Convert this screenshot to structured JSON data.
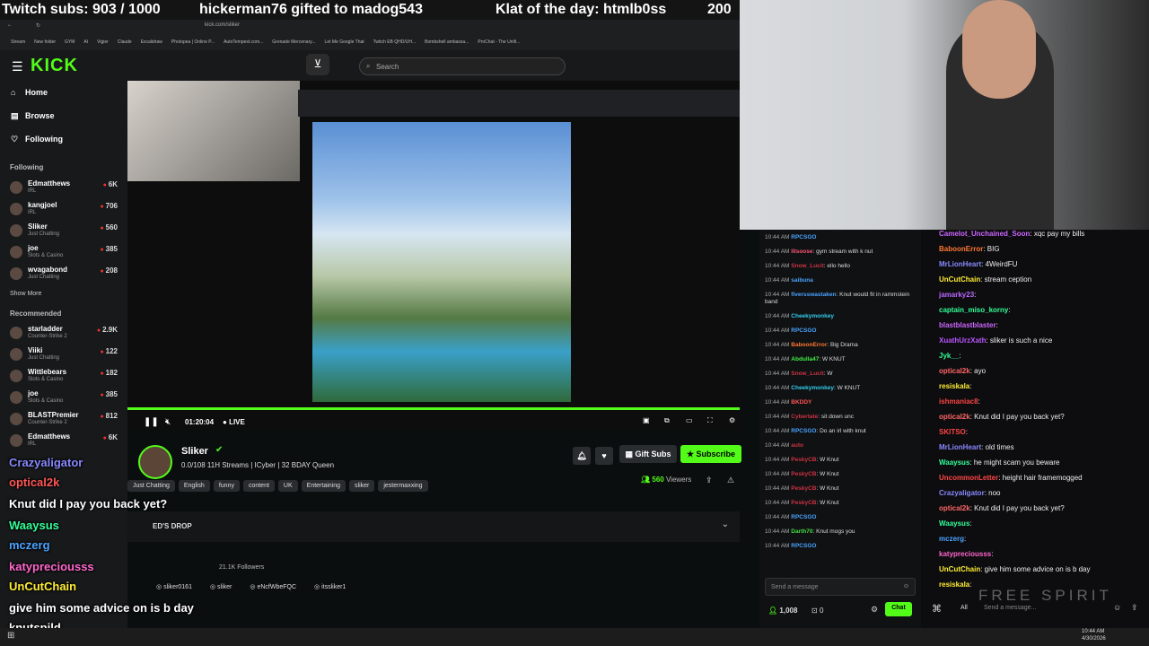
{
  "overlay": {
    "sub_count": "Twitch subs: 903 / 1000",
    "gift": "hickerman76 gifted to madog543",
    "klat": "Klat of the day: htmlb0ss",
    "klat_num": "200"
  },
  "browser": {
    "url": "kick.com/sliker",
    "bookmarks": [
      "Stream",
      "New folder",
      "GYM",
      "AI",
      "Vigier",
      "Claude",
      "Excalidraw",
      "Photopea | Online P...",
      "AutoTempest.com...",
      "Grenade Mercenary...",
      "Let Me Google That",
      "Twitch EB QHD/UH...",
      "Bombshell ambassa...",
      "ProChat - The Unifi..."
    ]
  },
  "kick": {
    "logo": "KICK",
    "search_placeholder": "Search",
    "nav": [
      {
        "label": "Home",
        "icon": "home-icon"
      },
      {
        "label": "Browse",
        "icon": "browse-icon"
      },
      {
        "label": "Following",
        "icon": "heart-icon"
      }
    ],
    "following_heading": "Following",
    "following": [
      {
        "name": "Edmatthews",
        "cat": "IRL",
        "viewers": "6K"
      },
      {
        "name": "kangjoel",
        "cat": "IRL",
        "viewers": "706"
      },
      {
        "name": "Sliker",
        "cat": "Just Chatting",
        "viewers": "560"
      },
      {
        "name": "joe",
        "cat": "Slots & Casino",
        "viewers": "385"
      },
      {
        "name": "wvagabond",
        "cat": "Just Chatting",
        "viewers": "208"
      }
    ],
    "show_more": "Show More",
    "recommended_heading": "Recommended",
    "recommended": [
      {
        "name": "starladder",
        "cat": "Counter-Strike 2",
        "viewers": "2.9K"
      },
      {
        "name": "Viiki",
        "cat": "Just Chatting",
        "viewers": "122"
      },
      {
        "name": "Wittlebears",
        "cat": "Slots & Casino",
        "viewers": "182"
      },
      {
        "name": "joe",
        "cat": "Slots & Casino",
        "viewers": "385"
      },
      {
        "name": "BLASTPremier",
        "cat": "Counter-Strike 2",
        "viewers": "812"
      },
      {
        "name": "Edmatthews",
        "cat": "IRL",
        "viewers": "6K"
      }
    ],
    "player": {
      "time": "01:20:04",
      "live": "LIVE"
    },
    "channel": {
      "name": "Sliker",
      "title": "0.0/108 11H Streams | ICyber | 32 BDAY Queen",
      "tags": [
        "Just Chatting",
        "English",
        "funny",
        "content",
        "UK",
        "Entertaining",
        "sliker",
        "jestermaxxing"
      ],
      "viewers": "560",
      "viewers_label": "Viewers",
      "gift_subs": "Gift Subs",
      "subscribe": "Subscribe",
      "drop": "ED'S DROP",
      "followers": "21.1K Followers",
      "socials": [
        "sliker0161",
        "sliker",
        "eNcfWbeFQC",
        "itssliker1"
      ]
    },
    "chat": {
      "messages": [
        {
          "t": "10:44 AM",
          "u": "RPCSGO",
          "m": "",
          "c": "#4aa3ff"
        },
        {
          "t": "10:44 AM",
          "u": "lllsoose",
          "m": "gym stream with k nut",
          "c": "#ff5577"
        },
        {
          "t": "10:44 AM",
          "u": "Snow_Lucit",
          "m": "ello hello",
          "c": "#cc3344"
        },
        {
          "t": "10:44 AM",
          "u": "saibuna",
          "m": "",
          "c": "#4aa3ff"
        },
        {
          "t": "10:44 AM",
          "u": "fiversswastaken",
          "m": "Knut would fit in rammstein band",
          "c": "#4aa3ff"
        },
        {
          "t": "10:44 AM",
          "u": "Cheekymonkey",
          "m": "",
          "c": "#33ccee"
        },
        {
          "t": "10:44 AM",
          "u": "RPCSGO",
          "m": "",
          "c": "#4aa3ff"
        },
        {
          "t": "10:44 AM",
          "u": "BaboonError",
          "m": "Big Drama",
          "c": "#ff7733"
        },
        {
          "t": "10:44 AM",
          "u": "Abdulla47",
          "m": "W KNUT",
          "c": "#44ee44"
        },
        {
          "t": "10:44 AM",
          "u": "Snow_Lucit",
          "m": "W",
          "c": "#cc3344"
        },
        {
          "t": "10:44 AM",
          "u": "Cheekymonkey",
          "m": "W KNUT",
          "c": "#33ccee"
        },
        {
          "t": "10:44 AM",
          "u": "BKDDY",
          "m": "",
          "c": "#ff5555"
        },
        {
          "t": "10:44 AM",
          "u": "Cybertate",
          "m": "sit down unc",
          "c": "#cc3344"
        },
        {
          "t": "10:44 AM",
          "u": "RPCSGO",
          "m": "Do an irl with knut",
          "c": "#4aa3ff"
        },
        {
          "t": "10:44 AM",
          "u": "auto",
          "m": "",
          "c": "#cc3344"
        },
        {
          "t": "10:44 AM",
          "u": "PeskyCB",
          "m": "W Knut",
          "c": "#cc3344"
        },
        {
          "t": "10:44 AM",
          "u": "PeskyCB",
          "m": "W Knut",
          "c": "#cc3344"
        },
        {
          "t": "10:44 AM",
          "u": "PeskyCB",
          "m": "W Knut",
          "c": "#cc3344"
        },
        {
          "t": "10:44 AM",
          "u": "PeskyCB",
          "m": "W Knut",
          "c": "#cc3344"
        },
        {
          "t": "10:44 AM",
          "u": "RPCSGO",
          "m": "",
          "c": "#4aa3ff"
        },
        {
          "t": "10:44 AM",
          "u": "Darth70",
          "m": "Knut mogs you",
          "c": "#44dd44"
        },
        {
          "t": "10:44 AM",
          "u": "RPCSGO",
          "m": "",
          "c": "#4aa3ff"
        }
      ],
      "input_placeholder": "Send a message",
      "count": "1,008",
      "zero": "0",
      "chat_button": "Chat"
    }
  },
  "twitch_chat": {
    "messages": [
      {
        "u": "Camelot_Unchained_Soon",
        "m": "xqc pay my bills",
        "c": "#cc66ff"
      },
      {
        "u": "BaboonError",
        "m": "BIG",
        "c": "#ff7733"
      },
      {
        "u": "MrLionHeart",
        "m": "4WeirdFU",
        "c": "#8888ff"
      },
      {
        "u": "UnCutChain",
        "m": "stream ception",
        "c": "#ffee33"
      },
      {
        "u": "jamarky23",
        "m": "",
        "c": "#bb66ff"
      },
      {
        "u": "captain_miso_korny",
        "m": "",
        "c": "#33ff99"
      },
      {
        "u": "blastblastblaster",
        "m": "",
        "c": "#cc66ff"
      },
      {
        "u": "XuathUrzXath",
        "m": "sliker is such a nice",
        "c": "#bb55ff"
      },
      {
        "u": "Jyk__",
        "m": "",
        "c": "#33ff99"
      },
      {
        "u": "optical2k",
        "m": "ayo",
        "c": "#ff6666"
      },
      {
        "u": "resiskala",
        "m": "",
        "c": "#ffee33"
      },
      {
        "u": "ishmaniac8",
        "m": "",
        "c": "#ff4444"
      },
      {
        "u": "optical2k",
        "m": "Knut did I pay you back yet?",
        "c": "#ff6666"
      },
      {
        "u": "SKITSO",
        "m": "",
        "c": "#ff4444"
      },
      {
        "u": "MrLionHeart",
        "m": "old times",
        "c": "#8888ff"
      },
      {
        "u": "Waaysus",
        "m": "he might scam you beware",
        "c": "#33ff99"
      },
      {
        "u": "UncommonLetter",
        "m": "height hair framemogged",
        "c": "#ff4444"
      },
      {
        "u": "Crazyaligator",
        "m": "noo",
        "c": "#8888ff"
      },
      {
        "u": "optical2k",
        "m": "Knut did I pay you back yet?",
        "c": "#ff6666"
      },
      {
        "u": "Waaysus",
        "m": "",
        "c": "#33ff99"
      },
      {
        "u": "mczerg",
        "m": "",
        "c": "#4aa3ff"
      },
      {
        "u": "katypreciousss",
        "m": "",
        "c": "#ff66cc"
      },
      {
        "u": "UnCutChain",
        "m": "give him some advice on is b day",
        "c": "#ffee33"
      },
      {
        "u": "resiskala",
        "m": "",
        "c": "#ffee33"
      }
    ],
    "input_placeholder": "Send a message...",
    "all_label": "All",
    "watermark": "FREE SPIRIT"
  },
  "overlay_chat": [
    {
      "u": "Crazyaligator",
      "m": "",
      "c": "#8888ff"
    },
    {
      "u": "optical2k",
      "m": "",
      "c": "#ff5555"
    },
    {
      "u": "",
      "m": "Knut did I pay you back yet?",
      "c": "#ffffff"
    },
    {
      "u": "Waaysus",
      "m": "",
      "c": "#33ff99"
    },
    {
      "u": "mczerg",
      "m": "",
      "c": "#4aa3ff"
    },
    {
      "u": "katypreciousss",
      "m": "",
      "c": "#ff66cc"
    },
    {
      "u": "UnCutChain",
      "m": "",
      "c": "#ffee33"
    },
    {
      "u": "",
      "m": "give him some advice on is b day",
      "c": "#ffffff"
    },
    {
      "u": "knutspild",
      "m": "",
      "c": "#ffffff"
    }
  ],
  "taskbar": {
    "time": "10:44 AM",
    "date": "4/30/2026"
  }
}
